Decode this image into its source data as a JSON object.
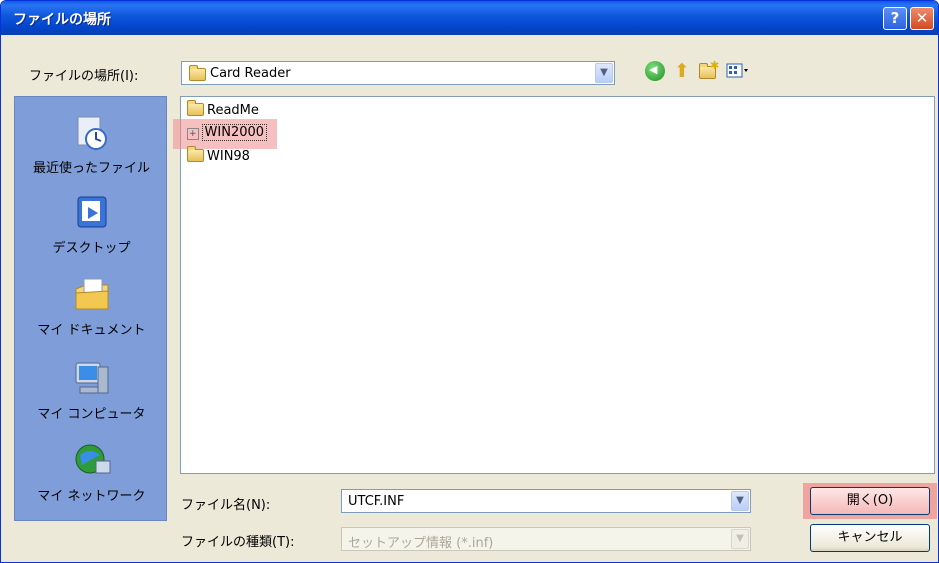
{
  "window": {
    "title": "ファイルの場所",
    "help_glyph": "?",
    "close_glyph": "✕"
  },
  "lookin": {
    "label": "ファイルの場所(I):",
    "value": "Card Reader"
  },
  "sidebar": {
    "items": [
      {
        "label": "最近使ったファイル",
        "icon": "recent-documents-icon"
      },
      {
        "label": "デスクトップ",
        "icon": "desktop-icon"
      },
      {
        "label": "マイ ドキュメント",
        "icon": "my-documents-icon"
      },
      {
        "label": "マイ コンピュータ",
        "icon": "my-computer-icon"
      },
      {
        "label": "マイ ネットワーク",
        "icon": "my-network-icon"
      }
    ]
  },
  "files": [
    {
      "name": "ReadMe"
    },
    {
      "name": "WIN2000"
    },
    {
      "name": "WIN98"
    }
  ],
  "filename": {
    "label": "ファイル名(N):",
    "value": "UTCF.INF"
  },
  "filetype": {
    "label": "ファイルの種類(T):",
    "value": "セットアップ情報 (*.inf)"
  },
  "buttons": {
    "open": "開く(O)",
    "cancel": "キャンセル"
  },
  "colors": {
    "titlebar": "#0a5ae8",
    "highlight": "#f08c8c",
    "sidebar": "#7f9ed9"
  }
}
